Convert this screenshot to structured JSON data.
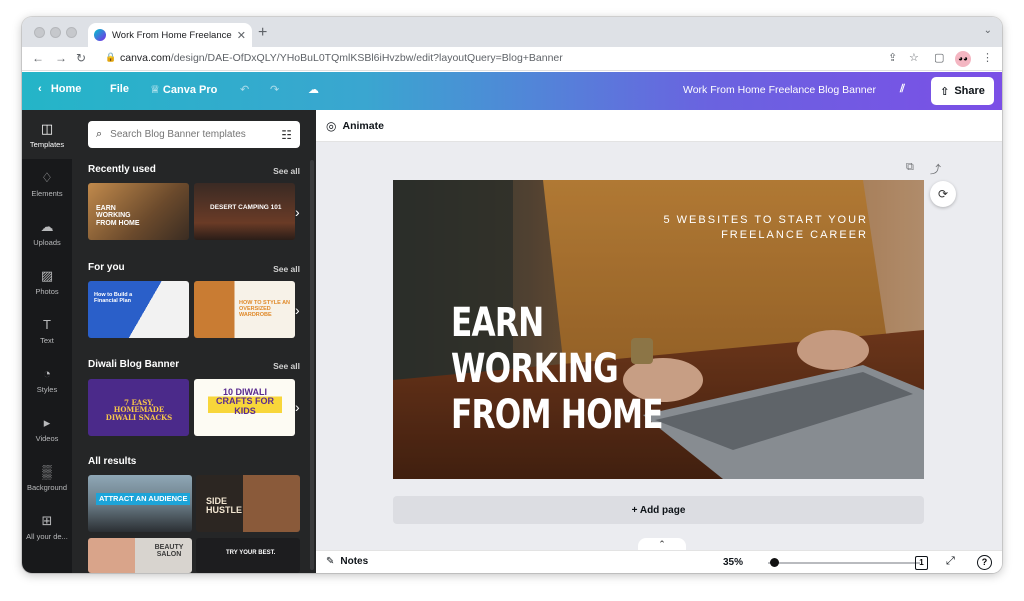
{
  "browser": {
    "tab_title": "Work From Home Freelance Bl…",
    "url_host": "canva.com",
    "url_path": "/design/DAE-OfDxQLY/YHoBuL0TQmlKSBl6iHvzbw/edit?layoutQuery=Blog+Banner"
  },
  "header": {
    "home": "Home",
    "file": "File",
    "canva_pro": "Canva Pro",
    "doc_title": "Work From Home Freelance Blog Banner",
    "share": "Share"
  },
  "rail": [
    {
      "label": "Templates",
      "icon": "templates-icon",
      "glyph": "◫"
    },
    {
      "label": "Elements",
      "icon": "elements-icon",
      "glyph": "♢"
    },
    {
      "label": "Uploads",
      "icon": "uploads-icon",
      "glyph": "☁"
    },
    {
      "label": "Photos",
      "icon": "photos-icon",
      "glyph": "▨"
    },
    {
      "label": "Text",
      "icon": "text-icon",
      "glyph": "T"
    },
    {
      "label": "Styles",
      "icon": "styles-icon",
      "glyph": "◔"
    },
    {
      "label": "Videos",
      "icon": "videos-icon",
      "glyph": "▸"
    },
    {
      "label": "Background",
      "icon": "background-icon",
      "glyph": "▒"
    },
    {
      "label": "All your de...",
      "icon": "all-designs-icon",
      "glyph": "⊞"
    }
  ],
  "panel": {
    "search_placeholder": "Search Blog Banner templates",
    "see_all": "See all",
    "recently_used": "Recently used",
    "for_you": "For you",
    "diwali": "Diwali Blog Banner",
    "all_results": "All results",
    "thumbs": {
      "earn": "EARN\nWORKING\nFROM HOME",
      "desert": "DESERT CAMPING 101",
      "plan": "How to Build a Financial Plan",
      "wardrobe": "HOW TO STYLE AN OVERSIZED WARDROBE",
      "snacks": "7 EASY, HOMEMADE DIWALI SNACKS",
      "crafts": "10 DIWALI CRAFTS FOR KIDS",
      "audience": "ATTRACT AN AUDIENCE",
      "hustle": "SIDE HUSTLE",
      "salon": "BEAUTY SALON",
      "try": "TRY YOUR BEST."
    }
  },
  "editor": {
    "animate": "Animate",
    "headline": [
      "EARN",
      "WORKING",
      "FROM HOME"
    ],
    "subline": [
      "5 WEBSITES TO START YOUR",
      "FREELANCE CAREER"
    ],
    "add_page": "+ Add page",
    "notes": "Notes",
    "zoom": "35%",
    "zoom_level": 0.04,
    "page_count": "1"
  }
}
